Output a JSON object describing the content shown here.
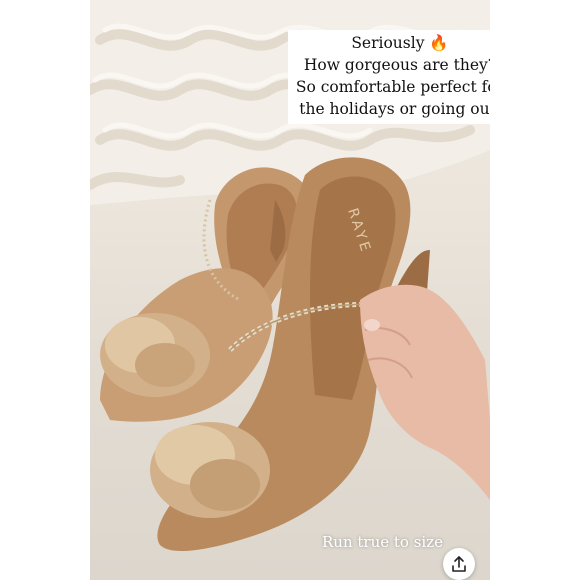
{
  "caption": {
    "line1": "Seriously 🔥",
    "line2": "How gorgeous are they?",
    "line3": "So comfortable perfect for",
    "line4": "the holidays or going out."
  },
  "overlay_text": "Run true to size",
  "brand": "RAYE",
  "share": {
    "icon": "share-icon"
  },
  "colors": {
    "background": "#ffffff",
    "suede": "#b8895e",
    "fur": "#d4b48e",
    "skin": "#e6b9a3"
  }
}
